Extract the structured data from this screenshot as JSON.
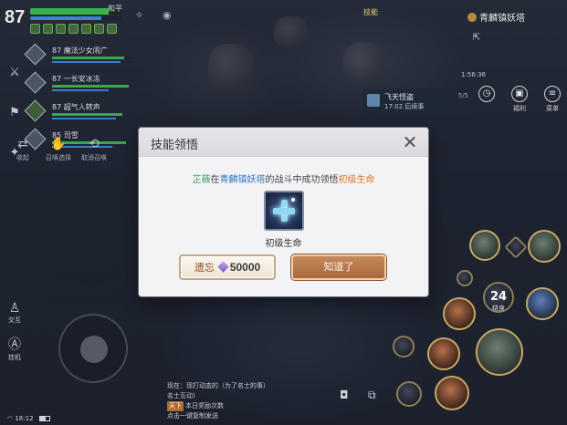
{
  "hud": {
    "player_level": "87",
    "hp_fraction": 0.86,
    "mp_fraction": 0.78,
    "top_player_name": "和平",
    "top_mid_label": "技能",
    "map_name": "青麟镇妖塔",
    "clock_small": "1:56:36",
    "task": {
      "title": "飞天怪盗",
      "time_label": "17:02  后续事",
      "count": "5/5"
    },
    "menu_icons": [
      {
        "icon": "clock-icon",
        "glyph": "◷",
        "label": ""
      },
      {
        "icon": "gift-icon",
        "glyph": "▣",
        "label": "福利"
      },
      {
        "icon": "menu-icon",
        "glyph": "≡",
        "label": "菜单"
      }
    ]
  },
  "team": {
    "members": [
      {
        "level": "87",
        "name": "魔法少女闹广",
        "hp_fraction": 0.9,
        "mp_fraction": 0.85
      },
      {
        "level": "87",
        "name": "一长安冰冻",
        "hp_fraction": 0.95,
        "mp_fraction": 0.7
      },
      {
        "level": "87",
        "name": "超气人转声",
        "hp_fraction": 0.88,
        "mp_fraction": 0.8
      },
      {
        "level": "85",
        "name": "司雪",
        "hp_fraction": 0.92,
        "mp_fraction": 0.75
      }
    ]
  },
  "quick_actions": [
    {
      "icon": "shuffle-icon",
      "glyph": "⇄",
      "label": "收起"
    },
    {
      "icon": "hand-icon",
      "glyph": "✋",
      "label": "召唤选择"
    },
    {
      "icon": "follow-icon",
      "glyph": "⟲",
      "label": "取消召唤"
    }
  ],
  "left_controls": {
    "chat_label": "交互",
    "hang_label": "挂机"
  },
  "skills": {
    "center_count": "24",
    "center_sub": "绕身"
  },
  "chat": {
    "lines": [
      {
        "tag": "",
        "text": "现在：现打动态的（为了名士的事）"
      },
      {
        "tag": "",
        "text": "名士互动)"
      },
      {
        "tag": "天下",
        "text": "本日奖励次数"
      },
      {
        "tag": "",
        "text": "点击一键复制发送"
      }
    ]
  },
  "status_bar": {
    "time": "18:12"
  },
  "dialog": {
    "title": "技能领悟",
    "message": {
      "who": "芷薇",
      "connector1": "在",
      "place": "青麟镇妖塔",
      "connector2": "的战斗中成功领悟",
      "skill": "初级生命"
    },
    "skill_icon": "heal-plus-icon",
    "skill_label": "初级生命",
    "forget_button": {
      "label": "遗忘",
      "currency_icon": "gem-icon",
      "cost": "50000"
    },
    "ok_button": {
      "label": "知道了"
    }
  },
  "colors": {
    "who": "#2f9d5f",
    "place": "#3278c8",
    "skill": "#d47a2a",
    "ok_button": "#b3724a"
  }
}
